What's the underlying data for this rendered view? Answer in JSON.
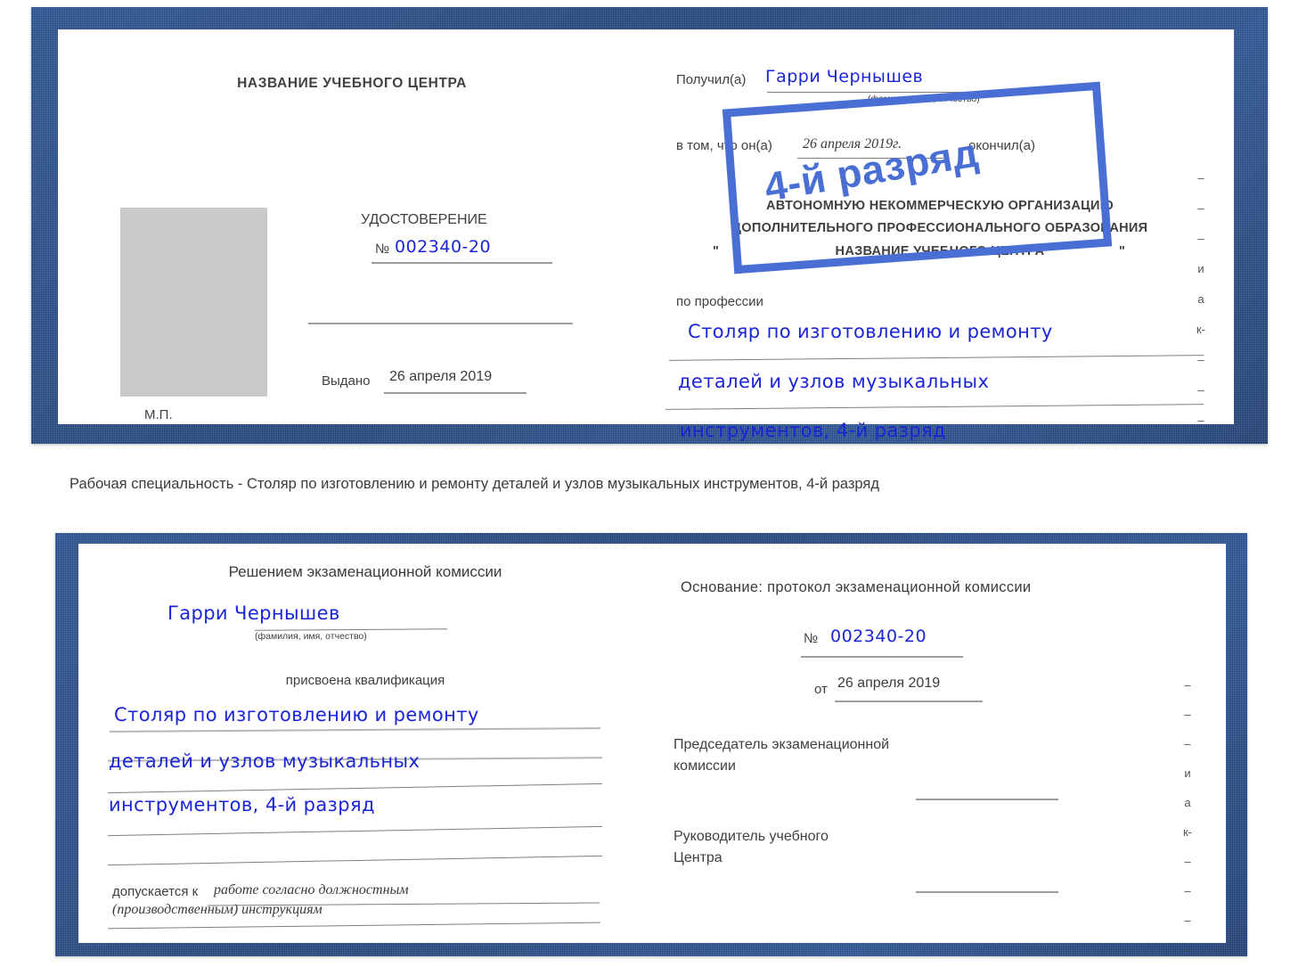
{
  "document": {
    "type": "certificate-booklet-scan",
    "colors": {
      "cover": "#27549b",
      "ink": "#1b25d8",
      "stamp": "#4a6fd4",
      "text": "#3c3c3c",
      "rule": "#9d9d9d"
    }
  },
  "caption": "Рабочая специальность - Столяр по изготовлению и ремонту деталей и узлов музыкальных инструментов, 4-й разряд",
  "top_certificate": {
    "left_page": {
      "header": "НАЗВАНИЕ УЧЕБНОГО ЦЕНТРА",
      "title": "УДОСТОВЕРЕНИЕ",
      "number_sign": "№",
      "number_value": "002340-20",
      "issued_label": "Выдано",
      "issued_value": "26 апреля 2019",
      "seal_label": "М.П.",
      "photo_placeholder": "photo-box"
    },
    "right_page": {
      "received_label": "Получил(а)",
      "received_value": "Гарри Чернышев",
      "fio_hint": "(фамилия, имя, отчество)",
      "that_label": "в том, что он(а)",
      "date_value": "26 апреля 2019г.",
      "finished_label": "окончил(а)",
      "org_line1": "АВТОНОМНУЮ НЕКОММЕРЧЕСКУЮ ОРГАНИЗАЦИЮ",
      "org_line2": "ДОПОЛНИТЕЛЬНОГО ПРОФЕССИОНАЛЬНОГО ОБРАЗОВАНИЯ",
      "org_quote_open": "\"",
      "org_name": "НАЗВАНИЕ УЧЕБНОГО ЦЕНТРА",
      "org_quote_close": "\"",
      "profession_label": "по профессии",
      "profession_line1": "Столяр по изготовлению и ремонту",
      "profession_line2": "деталей и узлов музыкальных",
      "profession_line3": "инструментов, 4-й разряд",
      "stamp_text": "4-й разряд",
      "edge_fragments": [
        "–",
        "–",
        "–",
        "и",
        "а",
        "к-",
        "–",
        "–",
        "–"
      ]
    }
  },
  "bottom_certificate": {
    "left_page": {
      "header": "Решением экзаменационной комиссии",
      "name_value": "Гарри Чернышев",
      "fio_hint": "(фамилия, имя, отчество)",
      "qualification_label": "присвоена квалификация",
      "qualification_line1": "Столяр по изготовлению и ремонту",
      "qualification_line2": "деталей и узлов музыкальных",
      "qualification_line3": "инструментов, 4-й разряд",
      "admitted_label": "допускается к",
      "admitted_value_line1": "работе согласно должностным",
      "admitted_value_line2": "(производственным) инструкциям"
    },
    "right_page": {
      "basis_label": "Основание: протокол экзаменационной комиссии",
      "number_sign": "№",
      "number_value": "002340-20",
      "from_label": "от",
      "from_value": "26 апреля 2019",
      "chairman_line1": "Председатель экзаменационной",
      "chairman_line2": "комиссии",
      "head_line1": "Руководитель учебного",
      "head_line2": "Центра",
      "edge_fragments": [
        "–",
        "–",
        "–",
        "и",
        "а",
        "к-",
        "–",
        "–",
        "–",
        "–"
      ]
    }
  }
}
